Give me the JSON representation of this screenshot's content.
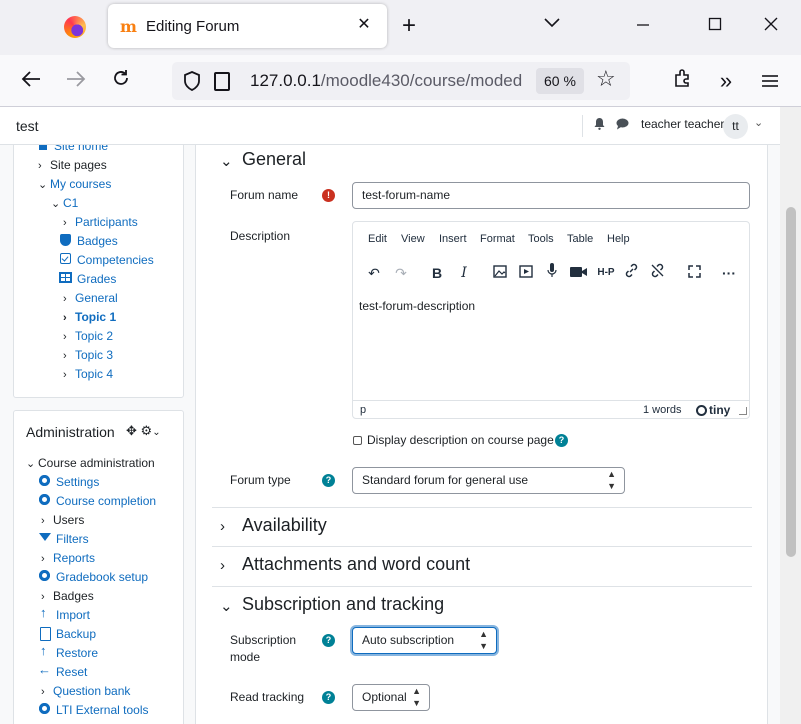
{
  "browser": {
    "tab_title": "Editing Forum",
    "tab_favicon": "m",
    "url_main": "127.0.0.1",
    "url_rest": "/moodle430/course/moded",
    "zoom": "60 %"
  },
  "header": {
    "site_title": "test",
    "user_name": "teacher teacher",
    "avatar_initials": "tt"
  },
  "nav_block": {
    "items": [
      {
        "label": "Site home"
      },
      {
        "label": "Site pages"
      },
      {
        "label": "My courses"
      },
      {
        "label": "C1"
      },
      {
        "label": "Participants"
      },
      {
        "label": "Badges"
      },
      {
        "label": "Competencies"
      },
      {
        "label": "Grades"
      },
      {
        "label": "General"
      },
      {
        "label": "Topic 1"
      },
      {
        "label": "Topic 2"
      },
      {
        "label": "Topic 3"
      },
      {
        "label": "Topic 4"
      }
    ]
  },
  "admin_block": {
    "title": "Administration",
    "items": [
      {
        "label": "Course administration"
      },
      {
        "label": "Settings"
      },
      {
        "label": "Course completion"
      },
      {
        "label": "Users"
      },
      {
        "label": "Filters"
      },
      {
        "label": "Reports"
      },
      {
        "label": "Gradebook setup"
      },
      {
        "label": "Badges"
      },
      {
        "label": "Import"
      },
      {
        "label": "Backup"
      },
      {
        "label": "Restore"
      },
      {
        "label": "Reset"
      },
      {
        "label": "Question bank"
      },
      {
        "label": "LTI External tools"
      }
    ]
  },
  "form": {
    "general_title": "General",
    "forum_name_label": "Forum name",
    "forum_name_value": "test-forum-name",
    "description_label": "Description",
    "editor_menu": [
      "Edit",
      "View",
      "Insert",
      "Format",
      "Tools",
      "Table",
      "Help"
    ],
    "editor_content": "test-forum-description",
    "editor_path": "p",
    "editor_words": "1 words",
    "editor_brand": "tiny",
    "display_desc_label": "Display description on course page",
    "forum_type_label": "Forum type",
    "forum_type_value": "Standard forum for general use",
    "availability_title": "Availability",
    "attachments_title": "Attachments and word count",
    "subscription_title": "Subscription and tracking",
    "subscription_mode_label": "Subscription mode",
    "subscription_mode_value": "Auto subscription",
    "read_tracking_label": "Read tracking",
    "read_tracking_value": "Optional"
  }
}
